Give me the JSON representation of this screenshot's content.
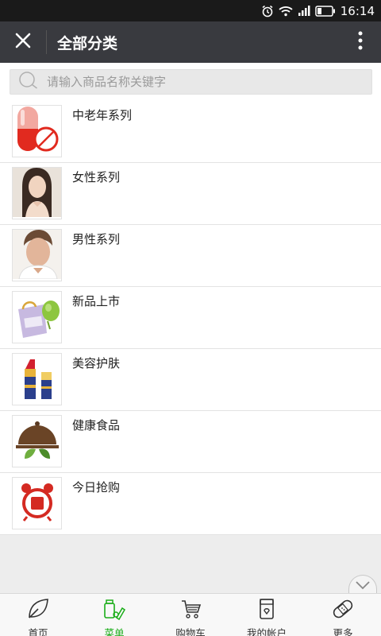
{
  "status": {
    "time": "16:14"
  },
  "navbar": {
    "title": "全部分类"
  },
  "search": {
    "placeholder": "请输入商品名称关键字"
  },
  "categories": [
    {
      "label": "中老年系列",
      "icon": "capsule-pill-icon"
    },
    {
      "label": "女性系列",
      "icon": "woman-portrait-icon"
    },
    {
      "label": "男性系列",
      "icon": "man-portrait-icon"
    },
    {
      "label": "新品上市",
      "icon": "shopping-bag-icon"
    },
    {
      "label": "美容护肤",
      "icon": "lipstick-icon"
    },
    {
      "label": "健康食品",
      "icon": "food-cloche-icon"
    },
    {
      "label": "今日抢购",
      "icon": "alarm-clock-icon"
    }
  ],
  "tabbar": {
    "tabs": [
      {
        "label": "首页",
        "icon": "leaf-icon"
      },
      {
        "label": "菜单",
        "icon": "menu-products-icon",
        "active": true
      },
      {
        "label": "购物车",
        "icon": "cart-icon"
      },
      {
        "label": "我的帐户",
        "icon": "account-icon"
      },
      {
        "label": "更多",
        "icon": "bandage-icon"
      }
    ]
  },
  "colors": {
    "accent": "#1aad19",
    "navbar": "#393a3f",
    "statusbar": "#1a1a1a"
  }
}
